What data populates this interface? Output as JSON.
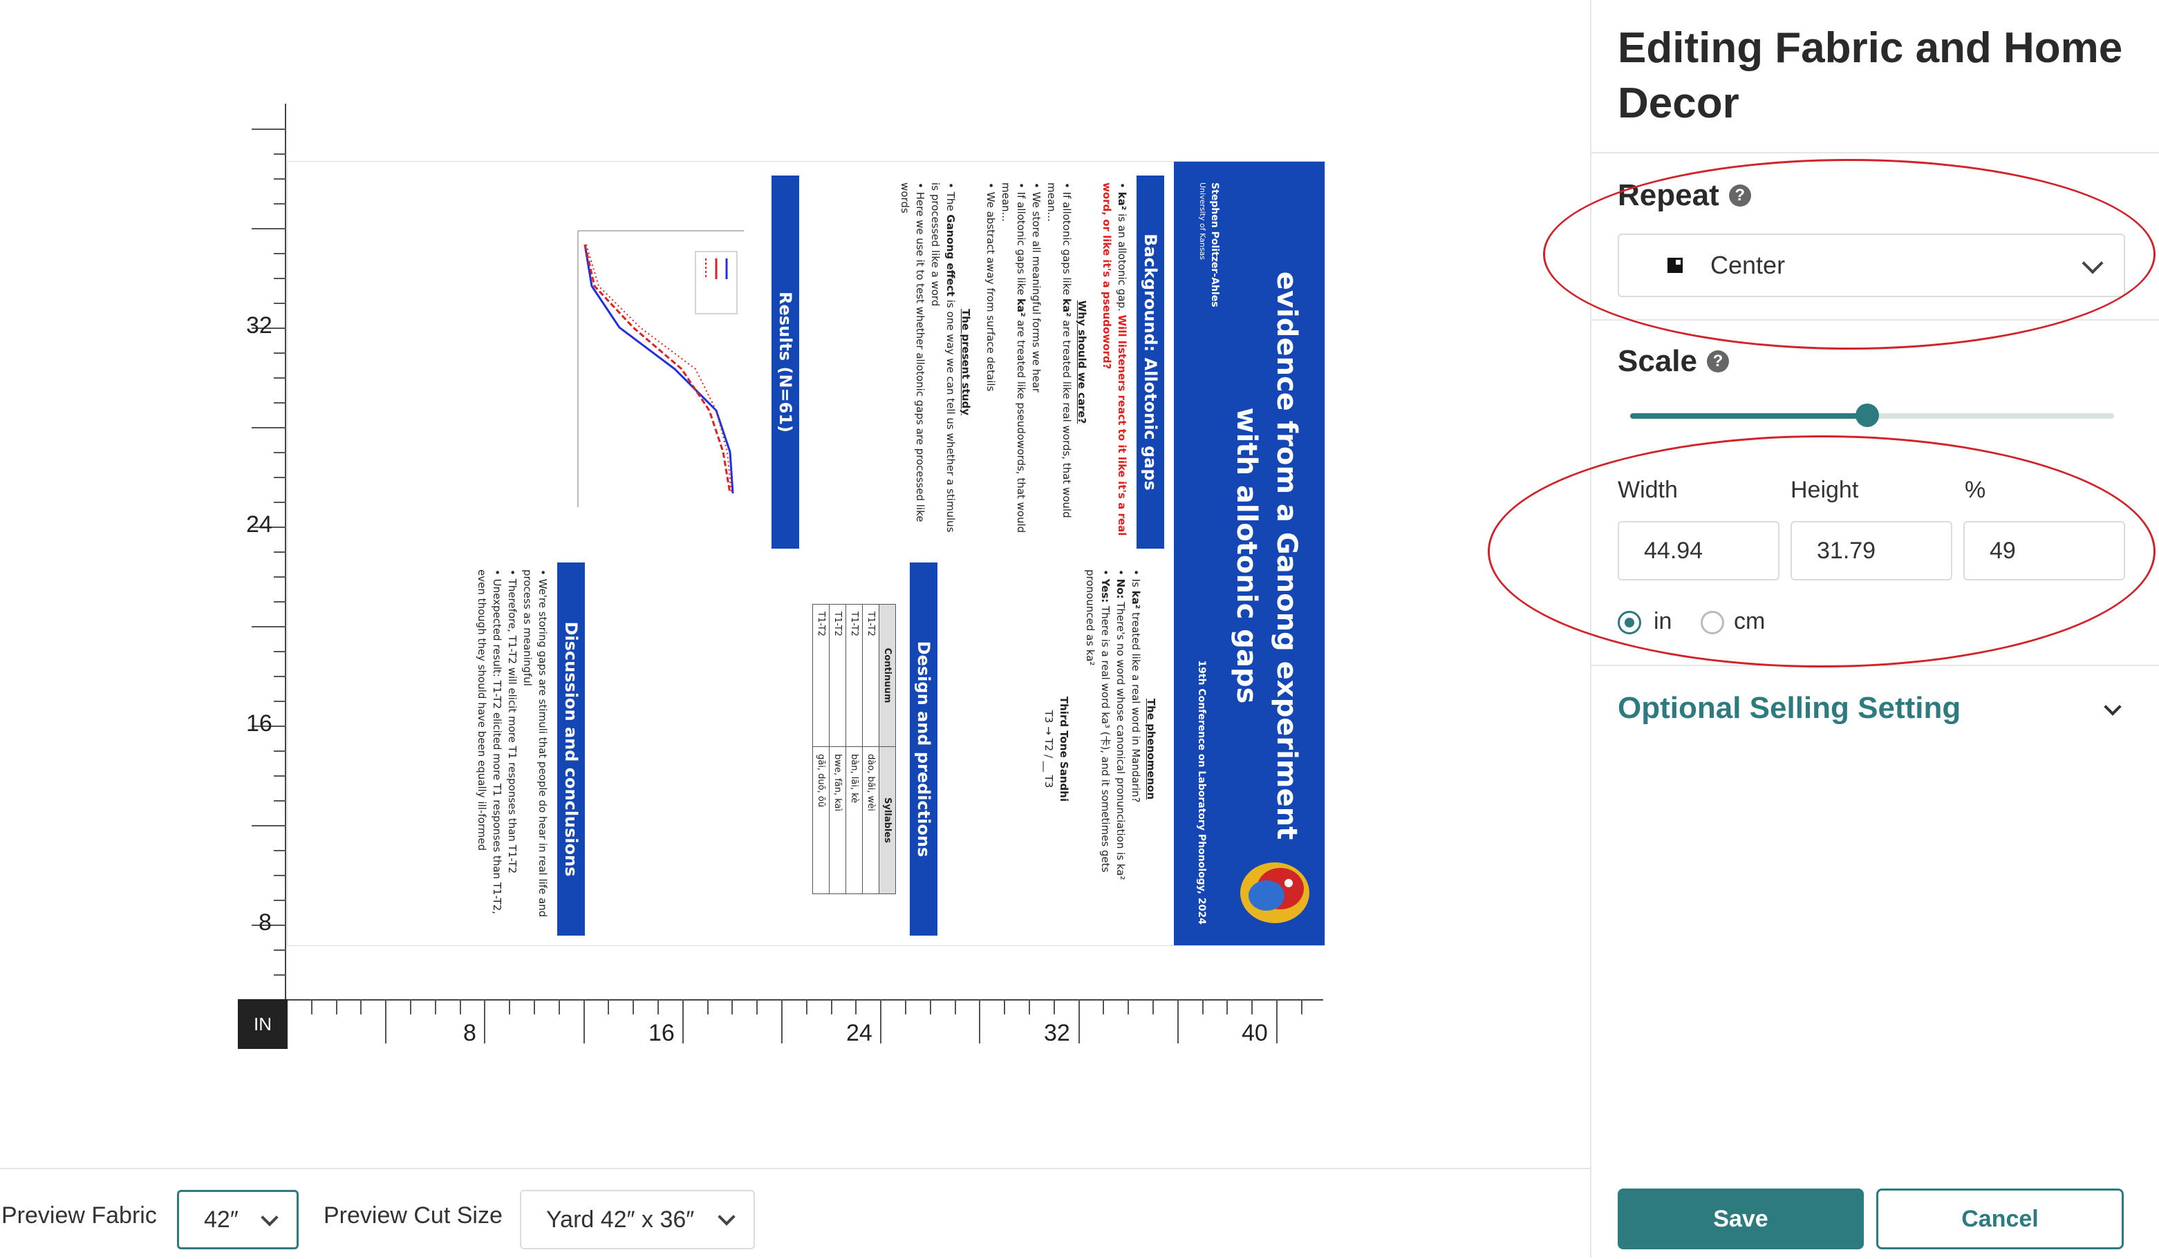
{
  "panel": {
    "title": "Editing Fabric and Home Decor",
    "repeat_label": "Repeat",
    "repeat_value": "Center",
    "scale_label": "Scale",
    "scale_fraction": 0.49,
    "width_label": "Width",
    "height_label": "Height",
    "percent_label": "%",
    "width_value": "44.94",
    "height_value": "31.79",
    "percent_value": "49",
    "unit_in": "in",
    "unit_cm": "cm",
    "selected_unit": "in",
    "optional_label": "Optional Selling Setting",
    "save_label": "Save",
    "cancel_label": "Cancel"
  },
  "bottom": {
    "preview_fabric_label": "Preview Fabric",
    "preview_fabric_value": "42″",
    "preview_cut_label": "Preview Cut Size",
    "preview_cut_value": "Yard 42″ x 36″"
  },
  "ruler": {
    "unit": "IN",
    "vertical_labels": [
      "32",
      "24",
      "16",
      "8"
    ],
    "horizontal_labels": [
      "8",
      "16",
      "24",
      "32",
      "40"
    ]
  },
  "poster": {
    "title": "evidence from a Ganong experiment with allotonic gaps",
    "author": "Stephen Politzer-Ahles",
    "affiliation": "University of Kansas",
    "conference": "19th Conference on Laboratory Phonology, 2024",
    "sections": {
      "background": "Background: Allotonic gaps",
      "design": "Design and predictions",
      "results": "Results (N=61)",
      "discussion": "Discussion and conclusions"
    },
    "phenomenon_heading": "The phenomenon",
    "why_heading": "Why should we care?",
    "present_heading": "The present study",
    "sandhi_heading": "Third Tone Sandhi",
    "red_question": "Will listeners react to it like it's a real word, or like it's a pseudoword?",
    "table_headers": [
      "Continuum",
      "Syllables"
    ],
    "table_rows": [
      [
        "T1-T2",
        "dào, bāi, wèi"
      ],
      [
        "T1-T2",
        "bàn, lāi, kè"
      ],
      [
        "T1-T2",
        "bwe, fān, kaì"
      ],
      [
        "T1-T2",
        "gāi, duō, ōū"
      ]
    ]
  }
}
